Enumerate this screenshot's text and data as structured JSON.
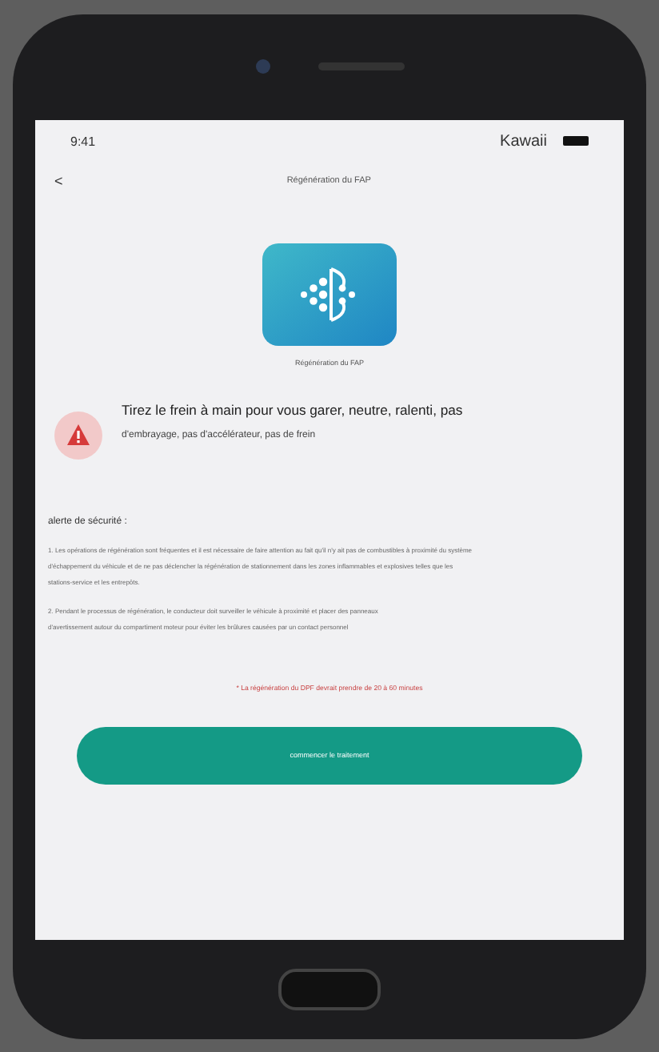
{
  "status_bar": {
    "time": "9:41",
    "carrier": "Kawaii"
  },
  "header": {
    "back": "<",
    "title": "Régénération du FAP"
  },
  "app": {
    "name": "Régénération du FAP"
  },
  "instruction": {
    "text": "Tirez le frein à main pour vous garer, neutre, ralenti, pas",
    "text_2": "d'embrayage, pas d'accélérateur, pas de frein"
  },
  "safety": {
    "title": "alerte de sécurité :",
    "items": [
      {
        "lines": [
          "1. Les opérations de régénération sont fréquentes et il est nécessaire de faire attention au fait qu'il n'y ait pas de combustibles à proximité du système",
          "d'échappement du véhicule et de ne pas déclencher la régénération de stationnement dans les zones inflammables et explosives telles que les",
          "stations-service et les entrepôts."
        ]
      },
      {
        "lines": [
          "2. Pendant le processus de régénération, le conducteur doit surveiller le véhicule à proximité et placer des panneaux",
          "d'avertissement autour du compartiment moteur pour éviter les brûlures causées par un contact personnel"
        ]
      }
    ]
  },
  "note": "* La régénération du DPF devrait prendre de 20 à 60 minutes",
  "button": "commencer le traitement"
}
